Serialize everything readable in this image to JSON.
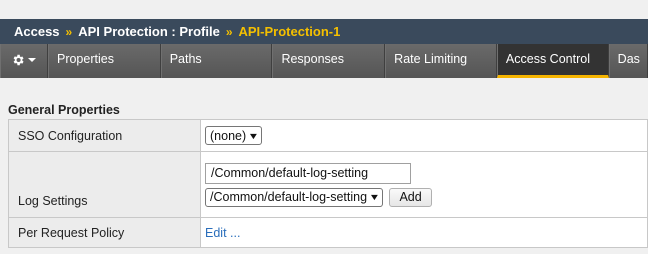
{
  "breadcrumb": {
    "items": [
      "Access",
      "API Protection : Profile",
      "API-Protection-1"
    ],
    "separator": "»"
  },
  "tabs": [
    {
      "label": "Properties",
      "active": false
    },
    {
      "label": "Paths",
      "active": false
    },
    {
      "label": "Responses",
      "active": false
    },
    {
      "label": "Rate Limiting",
      "active": false
    },
    {
      "label": "Access Control",
      "active": true
    },
    {
      "label": "Das",
      "active": false
    }
  ],
  "gear_icon": "gear-icon",
  "section": {
    "title": "General Properties",
    "rows": {
      "sso": {
        "label": "SSO Configuration",
        "selected": "(none)"
      },
      "log": {
        "label": "Log Settings",
        "input_value": "/Common/default-log-setting",
        "selected": "/Common/default-log-setting",
        "add_label": "Add"
      },
      "policy": {
        "label": "Per Request Policy",
        "link": "Edit ..."
      }
    }
  },
  "colors": {
    "title_bg": "#3a4a5c",
    "accent": "#f5b400",
    "link": "#2a6ebb"
  }
}
